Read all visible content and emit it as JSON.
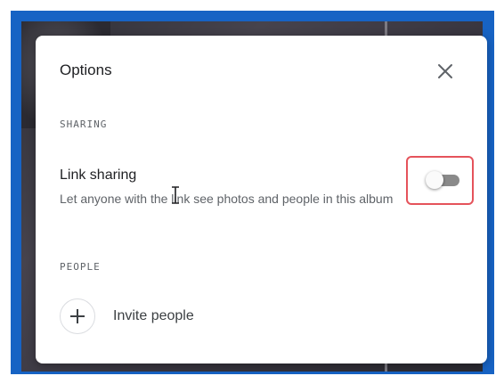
{
  "dialog": {
    "title": "Options",
    "close_icon": "close-icon"
  },
  "sharing": {
    "section_label": "SHARING",
    "link_sharing": {
      "title": "Link sharing",
      "description": "Let anyone with the link see photos and people in this album",
      "enabled": false
    }
  },
  "people": {
    "section_label": "PEOPLE",
    "invite_label": "Invite people",
    "invite_icon": "plus-icon"
  },
  "colors": {
    "frame": "#1763c4",
    "highlight": "#e5535b",
    "toggle_track": "#8a8a8a"
  }
}
